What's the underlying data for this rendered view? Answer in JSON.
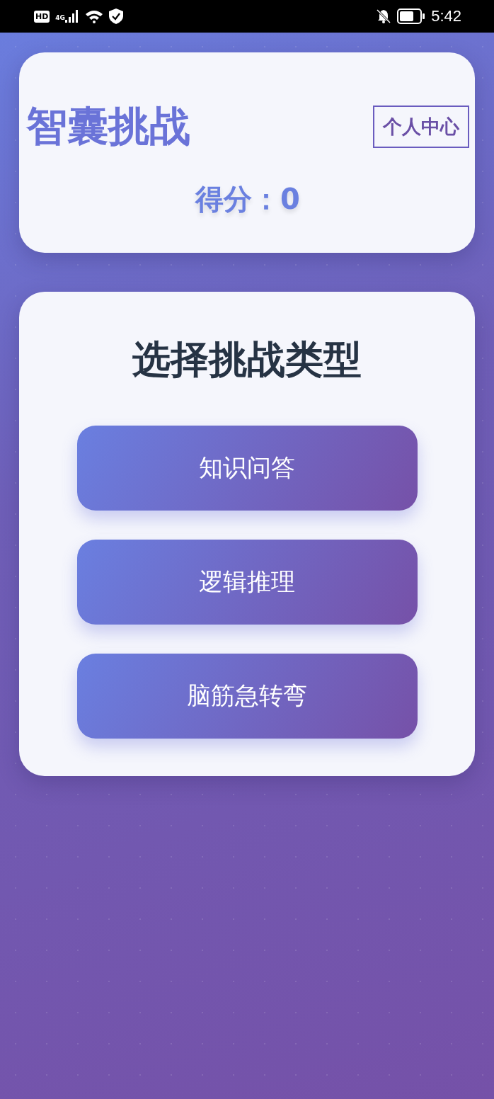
{
  "status_bar": {
    "hd": "HD",
    "network": "4G",
    "time": "5:42"
  },
  "header": {
    "title": "智囊挑战",
    "profile_button": "个人中心",
    "score": "得分：0"
  },
  "challenge_panel": {
    "title": "选择挑战类型",
    "options": [
      {
        "label": "知识问答"
      },
      {
        "label": "逻辑推理"
      },
      {
        "label": "脑筋急转弯"
      }
    ]
  }
}
